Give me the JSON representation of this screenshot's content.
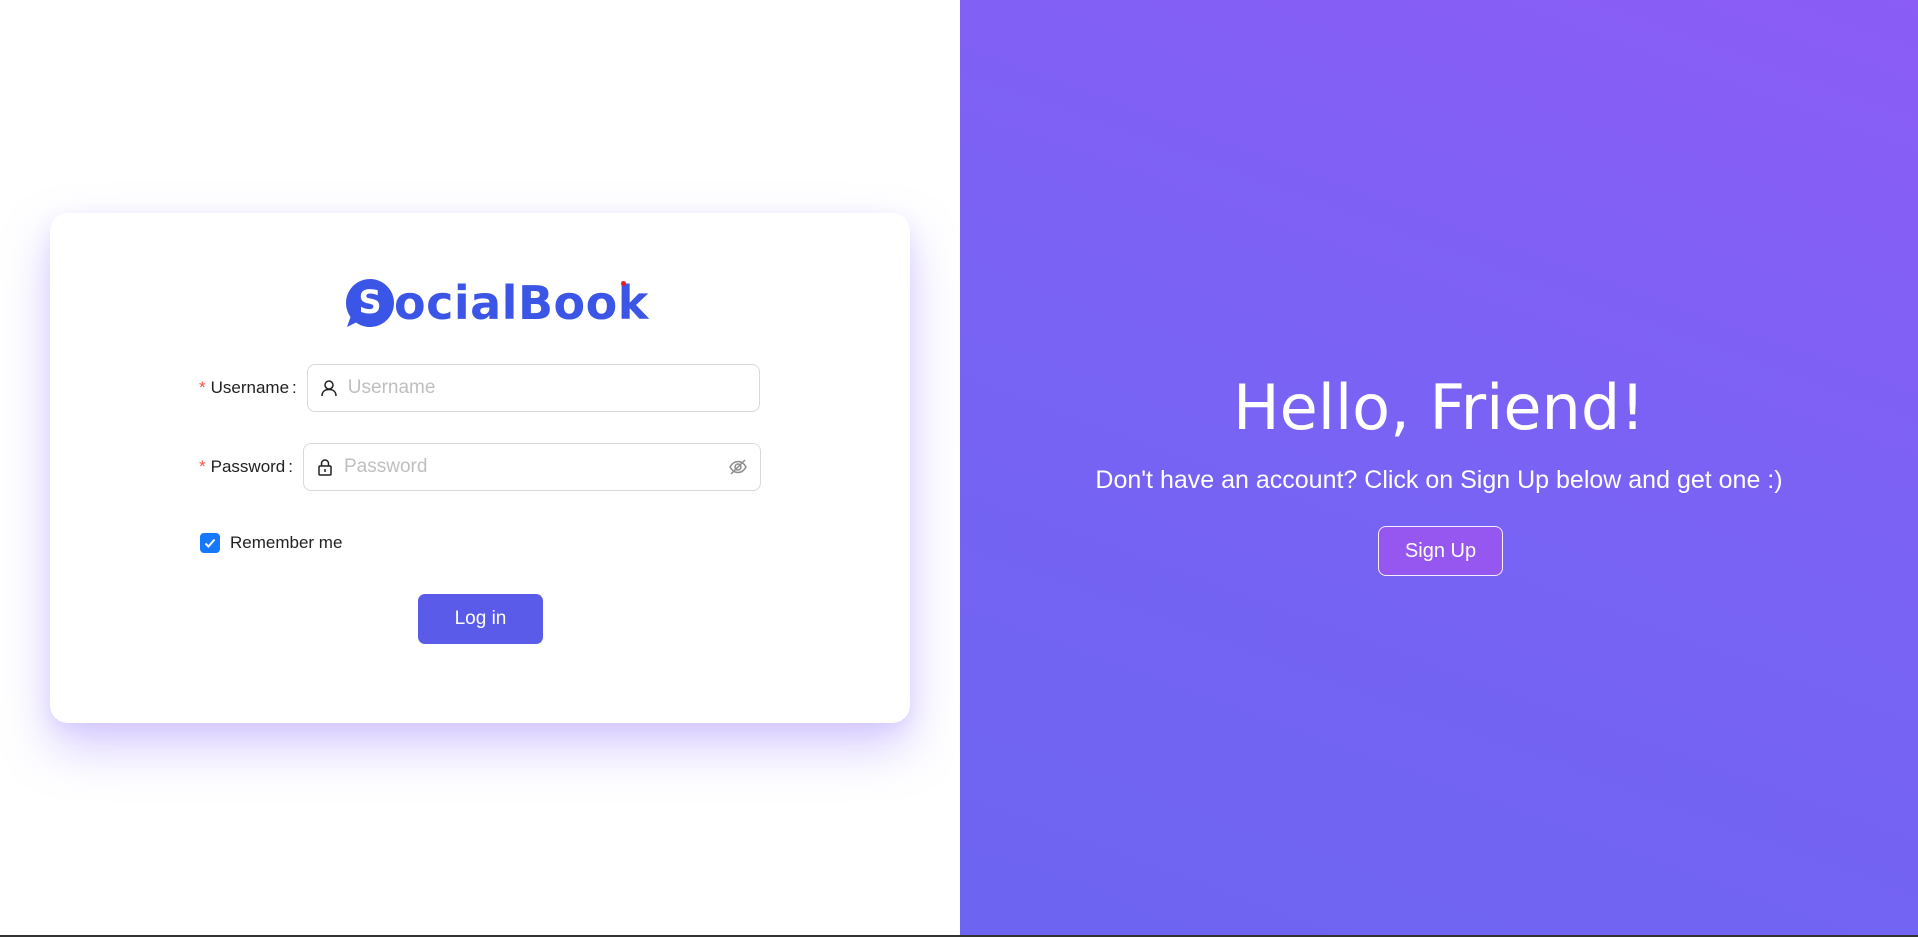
{
  "brand": {
    "name": "ocialBook",
    "logo_letter": "S",
    "logo_icon": "socialbook-logo-icon",
    "color": "#3b55e6"
  },
  "login_form": {
    "username": {
      "label": "Username",
      "placeholder": "Username",
      "value": "",
      "icon": "user-icon",
      "required": true
    },
    "password": {
      "label": "Password",
      "placeholder": "Password",
      "value": "",
      "icon": "lock-icon",
      "toggle_icon": "eye-invisible-icon",
      "required": true
    },
    "remember": {
      "label": "Remember me",
      "checked": true
    },
    "submit_label": "Log in"
  },
  "welcome_panel": {
    "heading": "Hello, Friend!",
    "message": "Don't have an account? Click on Sign Up below and get one :)",
    "signup_label": "Sign Up"
  },
  "colors": {
    "accent": "#5b5be9",
    "panel_gradient_start": "#8b5cf6",
    "panel_gradient_end": "#6d64f2",
    "required_marker": "#ff4d4f",
    "checkbox": "#1677ff"
  }
}
